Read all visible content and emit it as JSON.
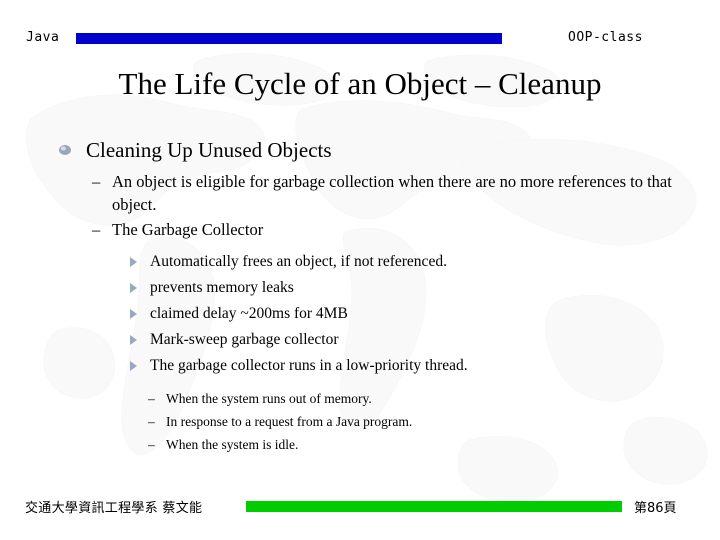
{
  "header": {
    "left_label": "Java",
    "right_label": "OOP-class",
    "bar_color": "#0000cc"
  },
  "title": "The Life Cycle of an Object – Cleanup",
  "content": {
    "level1": "Cleaning Up Unused Objects",
    "level2": [
      "An object is eligible for garbage collection when there are no more references to that object.",
      "The Garbage Collector"
    ],
    "level3": [
      "Automatically frees an object, if not referenced.",
      "prevents memory leaks",
      "claimed delay  ~200ms for 4MB",
      "Mark-sweep garbage collector",
      "The garbage collector runs in a low-priority thread."
    ],
    "level4": [
      "When the system runs out of memory.",
      "In response to a request from a Java program.",
      "When the system is idle."
    ],
    "dash": "–"
  },
  "footer": {
    "left_label": "交通大學資訊工程學系  蔡文能",
    "page_label": "第86頁",
    "bar_color": "#00cc00"
  }
}
